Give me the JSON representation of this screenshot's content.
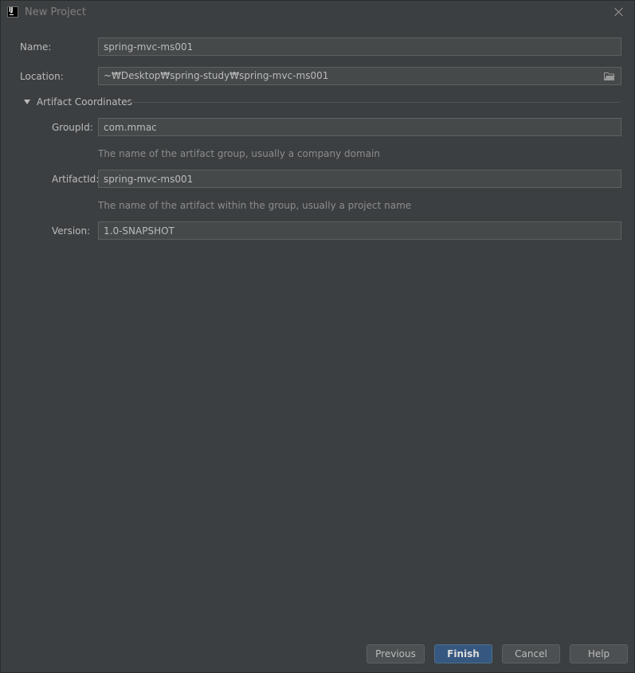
{
  "window": {
    "title": "New Project",
    "app_icon": "intellij-idea-icon",
    "app_icon_text": "IJ"
  },
  "form": {
    "name": {
      "label": "Name:",
      "value": "spring-mvc-ms001"
    },
    "location": {
      "label": "Location:",
      "value": "~₩Desktop₩spring-study₩spring-mvc-ms001",
      "icon": "folder-icon"
    },
    "section": {
      "title": "Artifact Coordinates",
      "expanded": true
    },
    "group_id": {
      "label": "GroupId:",
      "value": "com.mmac",
      "hint": "The name of the artifact group, usually a company domain"
    },
    "artifact_id": {
      "label": "ArtifactId:",
      "value": "spring-mvc-ms001",
      "hint": "The name of the artifact within the group, usually a project name"
    },
    "version": {
      "label": "Version:",
      "value": "1.0-SNAPSHOT"
    }
  },
  "buttons": {
    "previous": "Previous",
    "finish": "Finish",
    "cancel": "Cancel",
    "help": "Help"
  },
  "colors": {
    "background": "#3c3f41",
    "field_background": "#45494a",
    "primary_button": "#365880",
    "text": "#bbbbbb",
    "hint_text": "#8c8c8c"
  }
}
